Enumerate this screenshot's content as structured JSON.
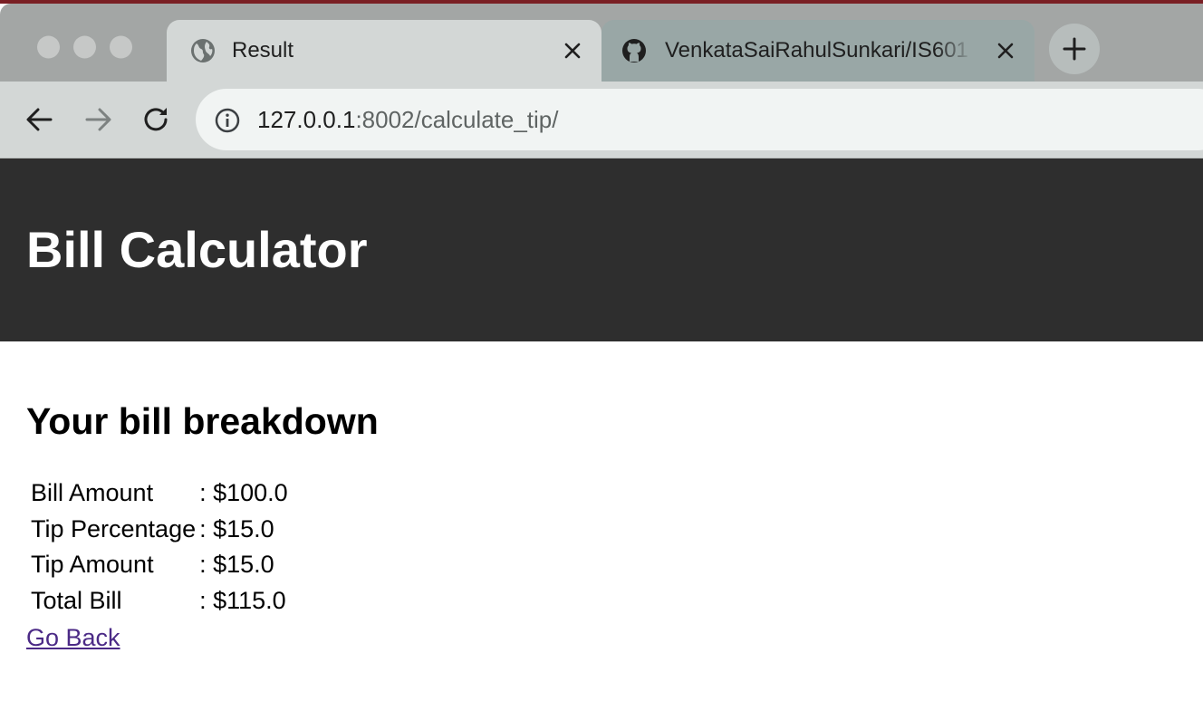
{
  "browser": {
    "tabs": [
      {
        "title": "Result",
        "active": true,
        "icon": "globe-icon"
      },
      {
        "title": "VenkataSaiRahulSunkari/IS601",
        "active": false,
        "icon": "github-icon"
      }
    ],
    "address_bar": {
      "host": "127.0.0.1",
      "path": ":8002/calculate_tip/"
    }
  },
  "page": {
    "header_title": "Bill Calculator",
    "section_title": "Your bill breakdown",
    "rows": [
      {
        "label": "Bill Amount",
        "value": ": $100.0"
      },
      {
        "label": "Tip Percentage",
        "value": ": $15.0"
      },
      {
        "label": "Tip Amount",
        "value": ": $15.0"
      },
      {
        "label": "Total Bill",
        "value": ": $115.0"
      }
    ],
    "back_link": "Go Back"
  },
  "colors": {
    "header_bg": "#2e2e2e",
    "link": "#4b2a86",
    "tab_active": "#d3d7d6",
    "tab_inactive": "#99a7a6"
  }
}
